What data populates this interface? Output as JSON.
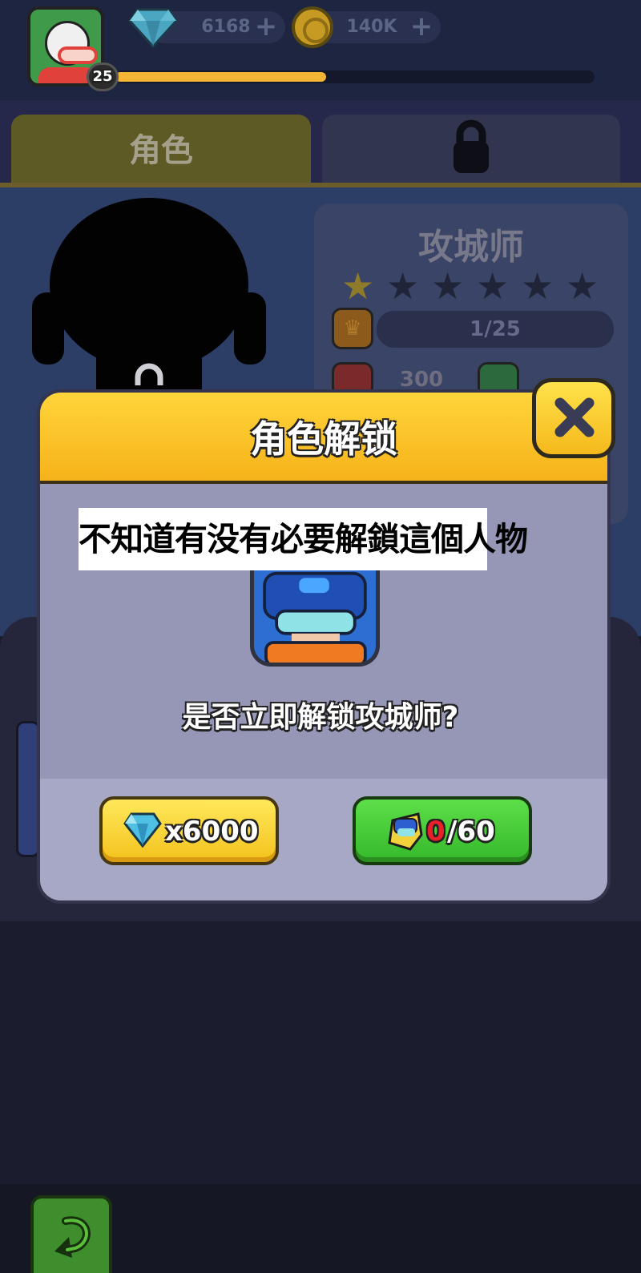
{
  "topbar": {
    "level": "25",
    "xp_progress": 0.44,
    "gems": "6168",
    "gold": "140K",
    "plus_symbol": "+"
  },
  "tabs": {
    "role_label": "角色",
    "locked_icon": "lock-icon"
  },
  "character": {
    "name": "攻城师",
    "stars_lit": 1,
    "stars_total": 6,
    "progress_text": "1/25",
    "hp_text": "300"
  },
  "dialog": {
    "title": "角色解锁",
    "caption": "不知道有没有必要解鎖這個人物",
    "question": "是否立即解锁攻城师?",
    "gem_cost_text": "x6000",
    "shard_owned": "0",
    "shard_needed": "/60"
  },
  "colors": {
    "dialog_header": "#f6b21a",
    "gem_button": "#f3c21d",
    "shard_button": "#35b82a",
    "close_button": "#f5b91c"
  },
  "icons": [
    "gem-icon",
    "gold-coin-icon",
    "lock-icon",
    "star-icon",
    "crown-icon",
    "close-icon",
    "shard-icon",
    "back-arrow-icon"
  ]
}
